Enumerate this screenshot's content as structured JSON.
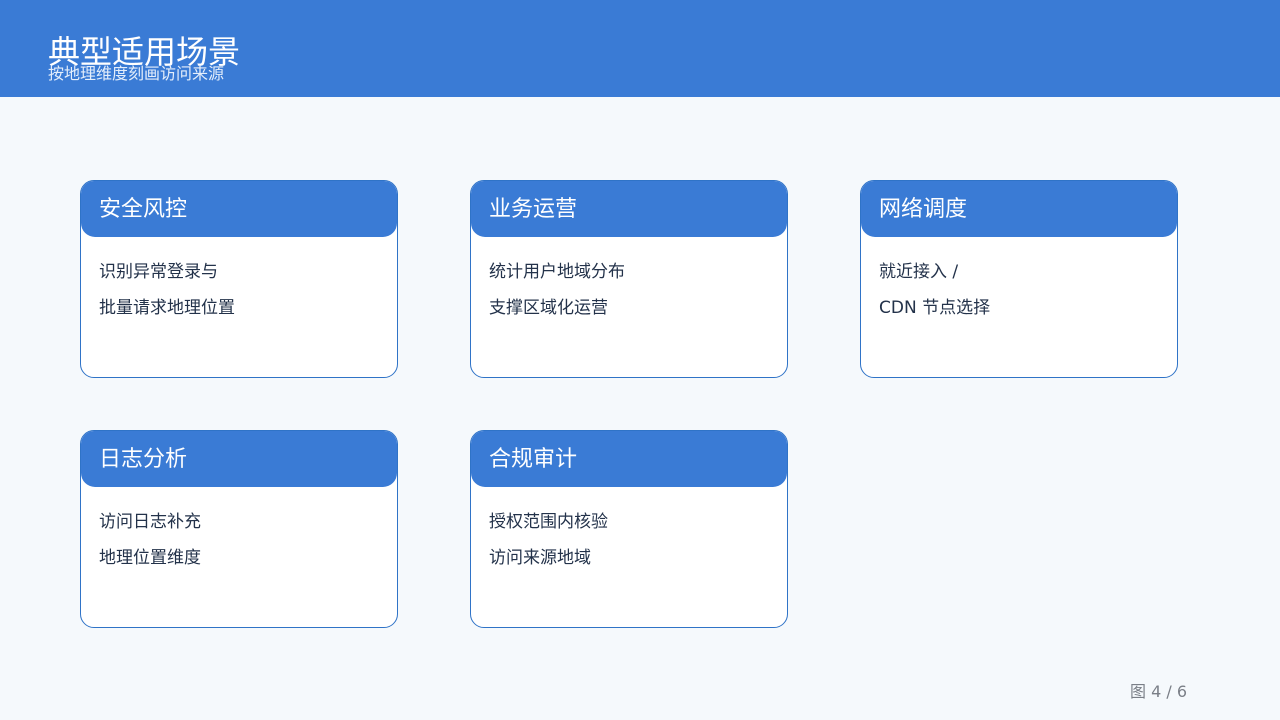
{
  "header": {
    "title": "典型适用场景",
    "subtitle": "按地理维度刻画访问来源"
  },
  "cards": [
    {
      "title": "安全风控",
      "lines": [
        "识别异常登录与",
        "批量请求地理位置"
      ]
    },
    {
      "title": "业务运营",
      "lines": [
        "统计用户地域分布",
        "支撑区域化运营"
      ]
    },
    {
      "title": "网络调度",
      "lines": [
        "就近接入 /",
        "CDN 节点选择"
      ]
    },
    {
      "title": "日志分析",
      "lines": [
        "访问日志补充",
        "地理位置维度"
      ]
    },
    {
      "title": "合规审计",
      "lines": [
        "授权范围内核验",
        "访问来源地域"
      ]
    }
  ],
  "footer": {
    "page_indicator": "图 4 / 6"
  },
  "colors": {
    "accent": "#3A7BD5",
    "border": "#2F73C7",
    "background": "#F5F9FC",
    "text": "#23324A"
  }
}
